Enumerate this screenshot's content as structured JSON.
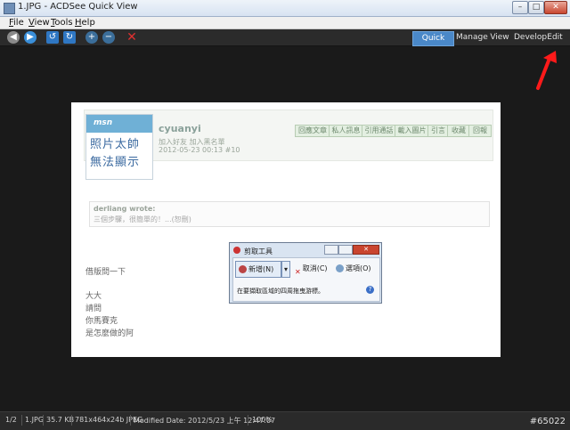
{
  "window": {
    "title": "1.JPG - ACDSee Quick View",
    "buttons": [
      "–",
      "□",
      "✕"
    ]
  },
  "menu": [
    "File",
    "View",
    "Tools",
    "Help"
  ],
  "toolbar": {
    "icons": [
      "previous-icon",
      "next-icon",
      "rotate-left-icon",
      "rotate-right-icon",
      "zoom-in-icon",
      "zoom-out-icon",
      "close-icon"
    ],
    "modes": [
      "Quick View",
      "Manage",
      "View",
      "Develop",
      "Edit"
    ],
    "active_mode": "Quick View"
  },
  "photo": {
    "avatar": {
      "brand": "msn",
      "line1": "照片太帥",
      "line2": "無法顯示"
    },
    "username": "cyuanyi",
    "sub1": "加入好友  加入黑名單",
    "sub2": "2012-05-23 00:13  #10",
    "tags": [
      "回應文章",
      "私人訊息",
      "引用通話",
      "載入圖片",
      "引言",
      "收藏",
      "回報"
    ],
    "quote_title": "derliang wrote:",
    "quote_body": "三個步驟，很簡單的！...(恕刪)",
    "body_lines": [
      "借版問一下",
      "大大",
      "請問",
      "你馬賽克",
      "是怎麼做的阿"
    ]
  },
  "snip": {
    "title": "剪取工具",
    "new_label": "新增(N)",
    "cancel_label": "取消(C)",
    "options_label": "選項(O)",
    "message": "在要擷取區域的四周拖曳游標。",
    "help": "?"
  },
  "status": {
    "index": "1/2",
    "filename": "1.JPG",
    "size": "35.7 KB",
    "dims": "781x464x24b JPEG",
    "modified": "Modified Date: 2012/5/23 上午 12:47:07",
    "zoom": "100%"
  },
  "watermark": "#65022",
  "colors": {
    "accent": "#4a88c8",
    "annotation_arrow": "#ff1a1a"
  }
}
